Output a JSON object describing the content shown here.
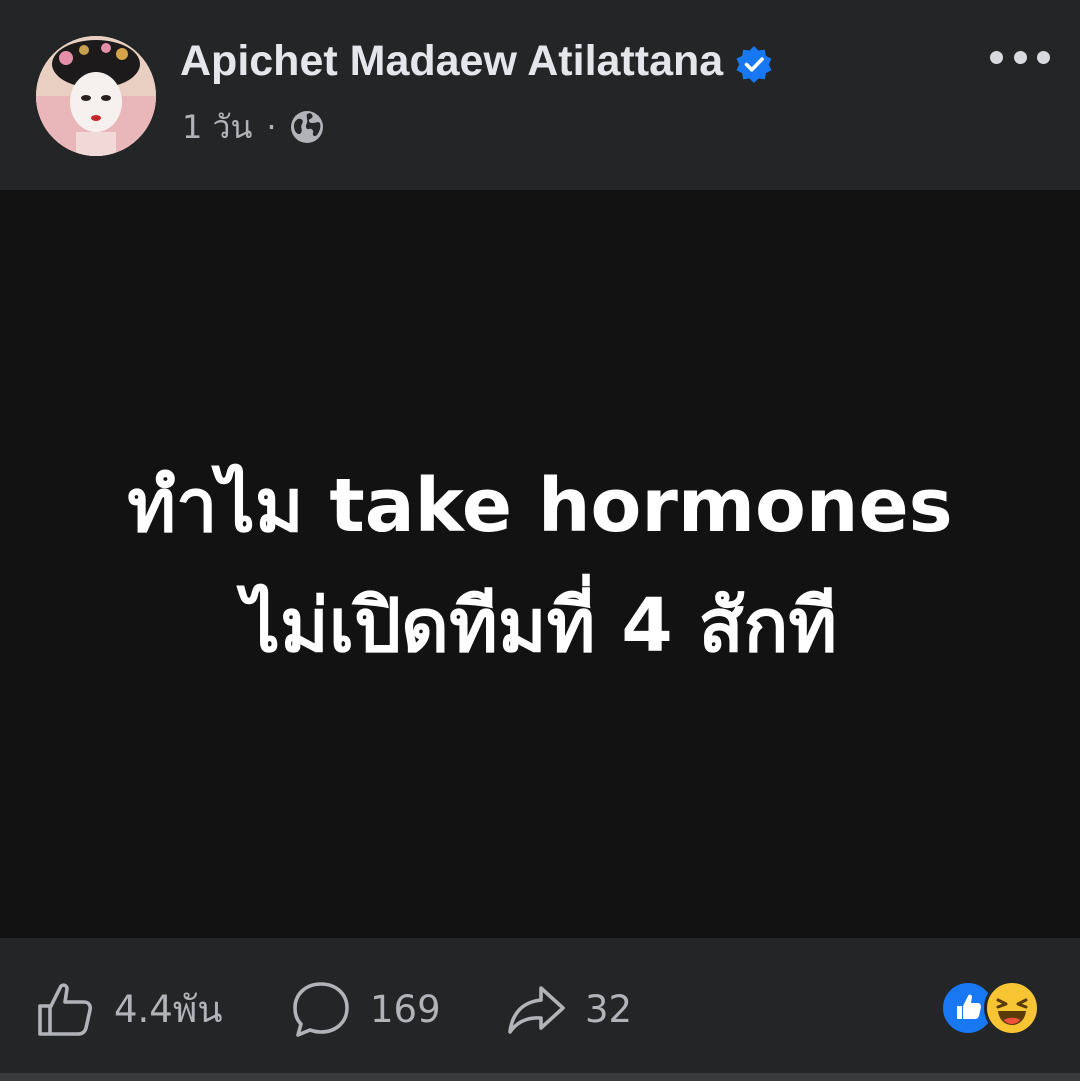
{
  "author": {
    "name": "Apichet Madaew Atilattana",
    "verified_icon": "verified-badge-icon"
  },
  "meta": {
    "time": "1 วัน",
    "separator": "·",
    "privacy_icon": "globe-icon"
  },
  "post": {
    "line1": "ทำไม take hormones",
    "line2": "ไม่เปิดทีมที่ 4 สักที"
  },
  "stats": {
    "likes": "4.4พัน",
    "comments": "169",
    "shares": "32"
  },
  "colors": {
    "background": "#242526",
    "post_background": "#121212",
    "accent": "#1877f2",
    "text": "#e4e6eb",
    "secondary_text": "#b0b3b8"
  }
}
